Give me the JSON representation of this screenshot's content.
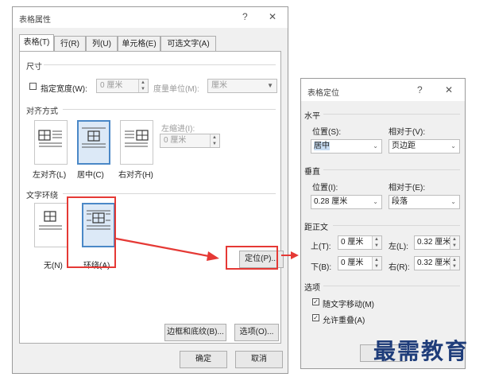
{
  "main_dialog": {
    "title": "表格属性",
    "help": "?",
    "close": "✕",
    "tabs": [
      "表格(T)",
      "行(R)",
      "列(U)",
      "单元格(E)",
      "可选文字(A)"
    ],
    "size_section": "尺寸",
    "preferred_width_label": "指定宽度(W):",
    "preferred_width_value": "0 厘米",
    "measure_label": "度量单位(M):",
    "measure_value": "厘米",
    "alignment_section": "对齐方式",
    "indent_label": "左缩进(I):",
    "indent_value": "0 厘米",
    "align_options": [
      "左对齐(L)",
      "居中(C)",
      "右对齐(H)"
    ],
    "align_selected": "居中(C)",
    "wrap_section": "文字环绕",
    "wrap_options": [
      "无(N)",
      "环绕(A)"
    ],
    "wrap_selected": "环绕(A)",
    "position_button": "定位(P)...",
    "borders_button": "边框和底纹(B)...",
    "options_button": "选项(O)...",
    "ok_button": "确定",
    "cancel_button": "取消"
  },
  "position_dialog": {
    "title": "表格定位",
    "help": "?",
    "close": "✕",
    "horizontal_section": "水平",
    "h_position_label": "位置(S):",
    "h_position_value": "居中",
    "h_relative_label": "相对于(V):",
    "h_relative_value": "页边距",
    "vertical_section": "垂直",
    "v_position_label": "位置(I):",
    "v_position_value": "0.28 厘米",
    "v_relative_label": "相对于(E):",
    "v_relative_value": "段落",
    "distance_section": "距正文",
    "top_label": "上(T):",
    "top_value": "0 厘米",
    "left_label": "左(L):",
    "left_value": "0.32 厘米",
    "bottom_label": "下(B):",
    "bottom_value": "0 厘米",
    "right_label": "右(R):",
    "right_value": "0.32 厘米",
    "options_section": "选项",
    "move_with_text_label": "随文字移动(M)",
    "move_with_text_checked": true,
    "allow_overlap_label": "允许重叠(A)",
    "allow_overlap_checked": true
  },
  "watermark": "最需教育",
  "colors": {
    "highlight_red": "#e53935",
    "selected_blue": "#4a88c7"
  }
}
